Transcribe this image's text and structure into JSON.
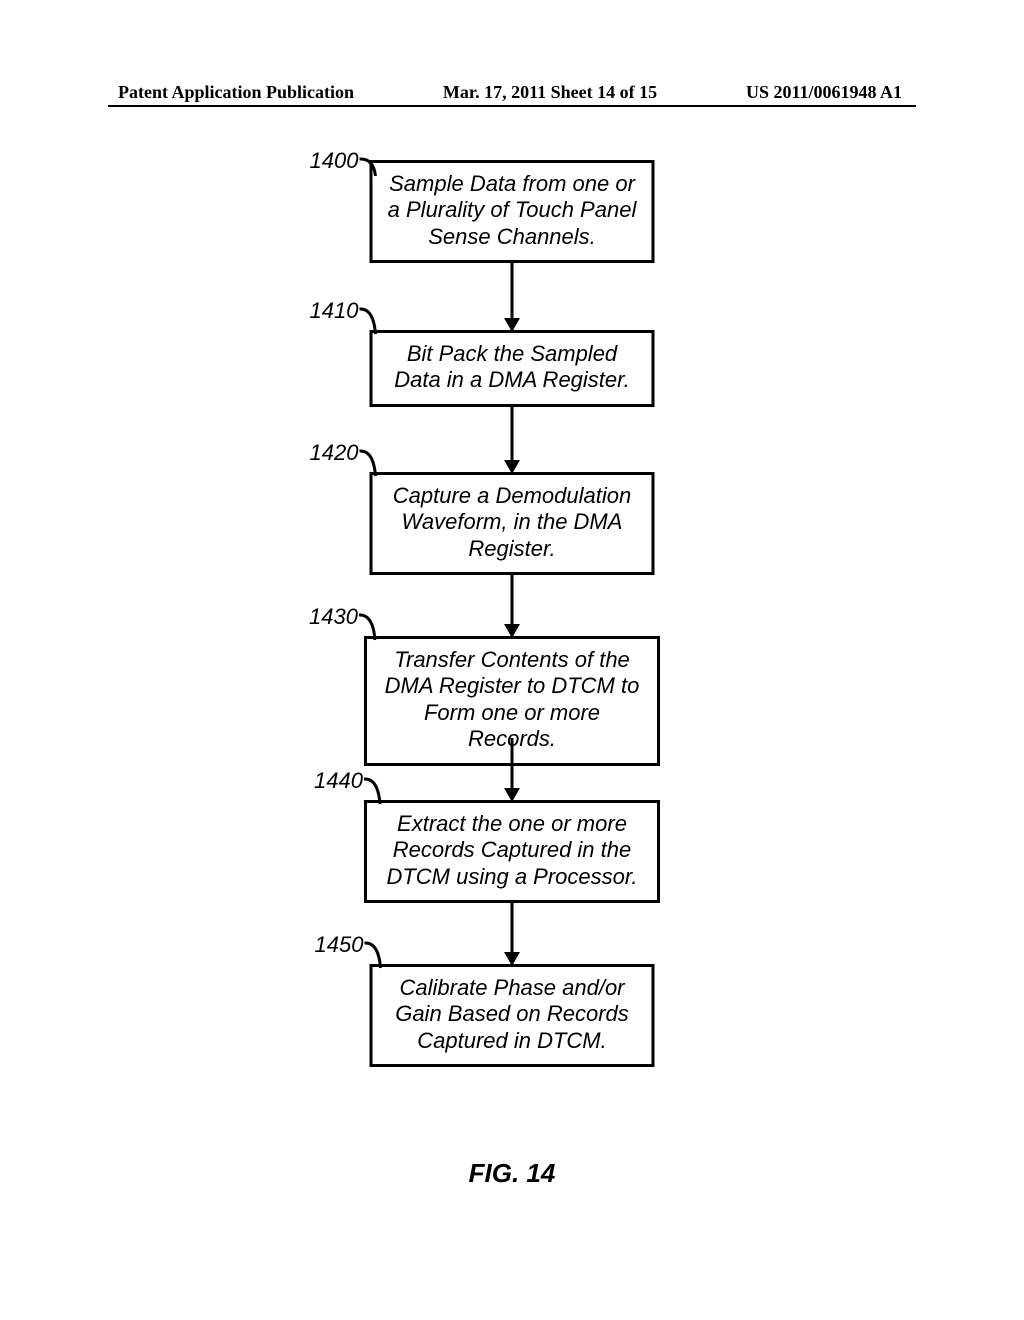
{
  "header": {
    "left": "Patent Application Publication",
    "center": "Mar. 17, 2011  Sheet 14 of 15",
    "right": "US 2011/0061948 A1"
  },
  "steps": [
    {
      "num": "1400",
      "text": "Sample Data from one or a Plurality of Touch Panel Sense Channels."
    },
    {
      "num": "1410",
      "text": "Bit Pack the Sampled Data in a DMA Register."
    },
    {
      "num": "1420",
      "text": "Capture a Demodulation Waveform, in the DMA Register."
    },
    {
      "num": "1430",
      "text": "Transfer Contents of the DMA Register to DTCM to Form one or more Records."
    },
    {
      "num": "1440",
      "text": "Extract the one or more Records Captured in the DTCM using a Processor."
    },
    {
      "num": "1450",
      "text": "Calibrate Phase and/or Gain Based on Records Captured in DTCM."
    }
  ],
  "figure_label": "FIG. 14"
}
